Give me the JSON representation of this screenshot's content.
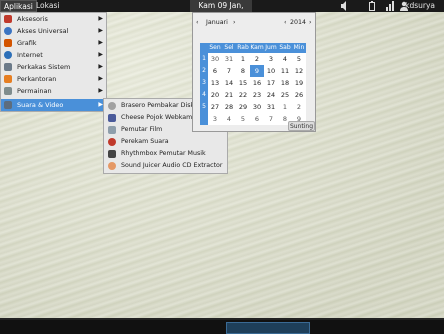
{
  "panel": {
    "applications": "Aplikasi",
    "places": "Lokasi",
    "clock": "Kam 09 Jan, 13:42",
    "user": "kdsurya"
  },
  "menu": {
    "items": [
      {
        "label": "Aksesoris",
        "icon": "accessories-icon",
        "color": "#c0392b"
      },
      {
        "label": "Akses Universal",
        "icon": "universal-access-icon",
        "color": "#3b74c2"
      },
      {
        "label": "Grafik",
        "icon": "graphics-icon",
        "color": "#d35400"
      },
      {
        "label": "Internet",
        "icon": "internet-icon",
        "color": "#2c6fb8"
      },
      {
        "label": "Perkakas Sistem",
        "icon": "system-tools-icon",
        "color": "#6c7a89"
      },
      {
        "label": "Perkantoran",
        "icon": "office-icon",
        "color": "#e67e22"
      },
      {
        "label": "Permainan",
        "icon": "games-icon",
        "color": "#7f8c8d"
      },
      {
        "label": "Suara & Video",
        "icon": "sound-video-icon",
        "color": "#5d6d7e"
      }
    ]
  },
  "submenu": {
    "items": [
      {
        "label": "Brasero Pembakar Diska",
        "icon": "brasero-icon",
        "color": "#a0a0a0"
      },
      {
        "label": "Cheese Pojok Webkam",
        "icon": "cheese-icon",
        "color": "#4a5a9a"
      },
      {
        "label": "Pemutar Film",
        "icon": "film-player-icon",
        "color": "#8e9eab"
      },
      {
        "label": "Perekam Suara",
        "icon": "sound-recorder-icon",
        "color": "#c0392b"
      },
      {
        "label": "Rhythmbox Pemutar Musik",
        "icon": "rhythmbox-icon",
        "color": "#444444"
      },
      {
        "label": "Sound Juicer Audio CD Extractor",
        "icon": "sound-juicer-icon",
        "color": "#e59866"
      }
    ]
  },
  "calendar": {
    "month": "Januari",
    "year": "2014",
    "prev": "‹",
    "next": "›",
    "days": [
      "Sen",
      "Sel",
      "Rab",
      "Kam",
      "Jum",
      "Sab",
      "Min"
    ],
    "weeks": [
      "1",
      "2",
      "3",
      "4",
      "5"
    ],
    "rows": [
      [
        "30",
        "31",
        "1",
        "2",
        "3",
        "4",
        "5"
      ],
      [
        "6",
        "7",
        "8",
        "9",
        "10",
        "11",
        "12"
      ],
      [
        "13",
        "14",
        "15",
        "16",
        "17",
        "18",
        "19"
      ],
      [
        "20",
        "21",
        "22",
        "23",
        "24",
        "25",
        "26"
      ],
      [
        "27",
        "28",
        "29",
        "30",
        "31",
        "1",
        "2"
      ],
      [
        "3",
        "4",
        "5",
        "6",
        "7",
        "8",
        "9"
      ]
    ],
    "today": "9",
    "edit": "Sunting"
  },
  "colors": {
    "accent": "#4a90d9",
    "panel": "#1a1a1a"
  }
}
